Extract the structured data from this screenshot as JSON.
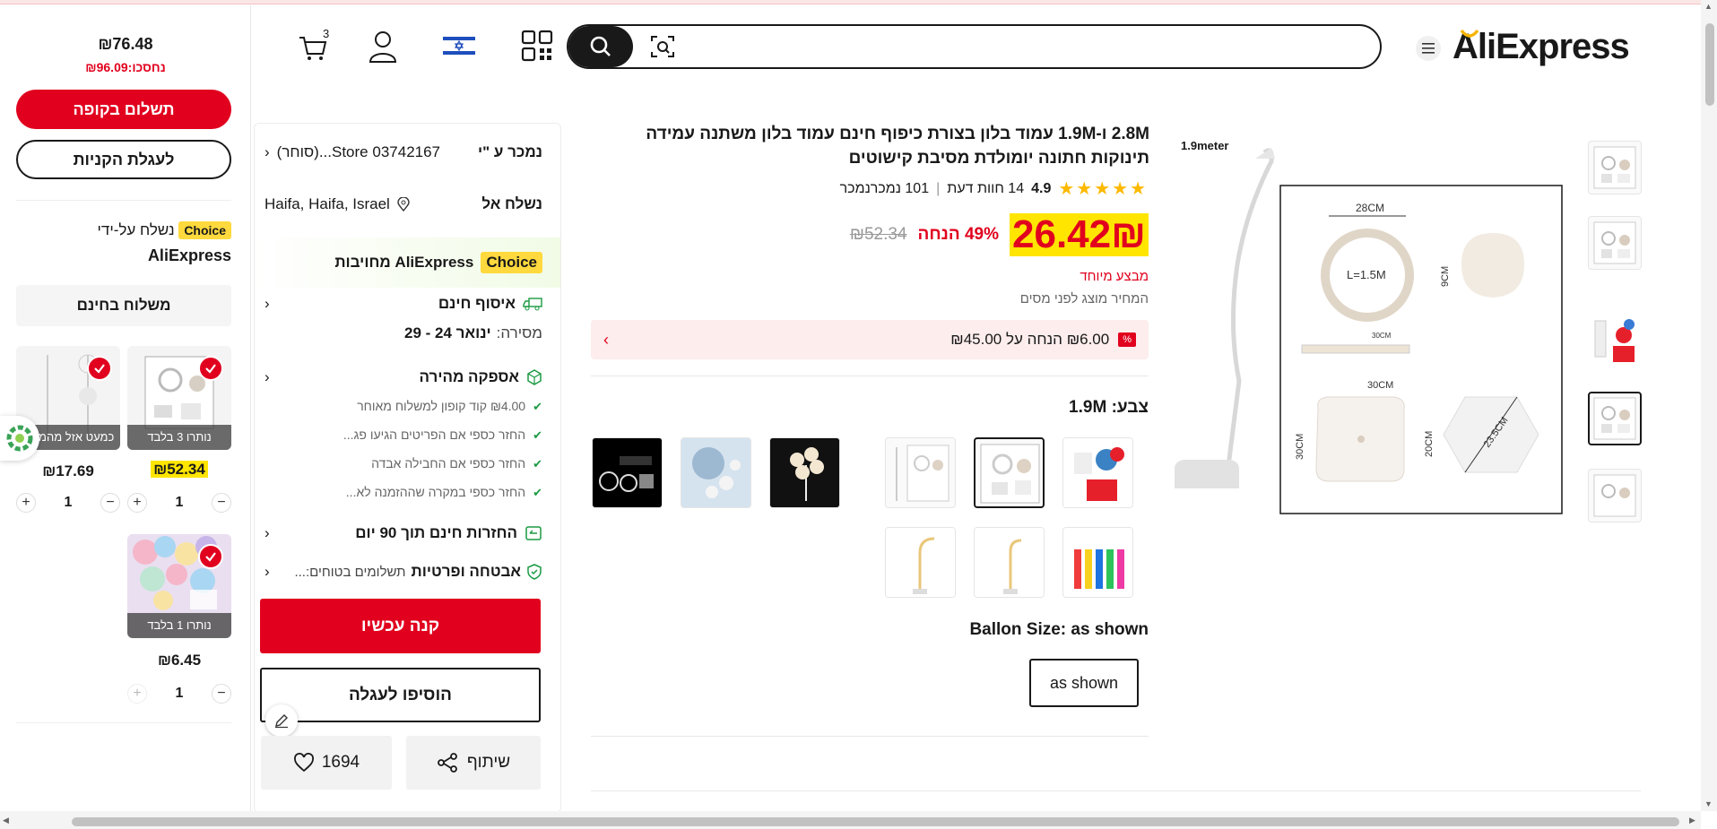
{
  "header": {
    "logo": "AliExpress",
    "cart_count": "3",
    "search_placeholder": "",
    "flag": "israel-flag"
  },
  "sidebar": {
    "total": "₪76.48",
    "saved": "נחסכו:₪96.09",
    "checkout_label": "תשלום בקופה",
    "to_cart_label": "לעגלת הקניות",
    "choice_badge": "Choice",
    "shipped_by": "נשלח על-ידי",
    "shipped_by_brand": "AliExpress",
    "free_shipping": "משלוח בחינם",
    "items": [
      {
        "caption": "נותרו 3 בלבד",
        "price": "₪52.34",
        "qty": "1"
      },
      {
        "caption": "כמעט אזל מהמלאי",
        "price": "₪17.69",
        "qty": "1"
      },
      {
        "caption": "נותרו 1 בלבד",
        "price": "₪6.45",
        "qty": "1"
      }
    ]
  },
  "product": {
    "title": "2.8M ו-1.9M עמוד בלון בצורת כיפוף חינם עמוד בלון משתנה עמידה תינוקות חתונה יומולדת מסיבת קישוטים",
    "rating": "4.9",
    "reviews": "14 חוות דעת",
    "sold": "101 נמכרנמכר",
    "price": "26.42₪",
    "discount": "49% הנחה",
    "old_price": "₪52.34",
    "special": "מבצע מיוחד",
    "tax_note": "המחיר מוצג לפני מסים",
    "coupon_text": "₪6.00 הנחה על ₪45.00",
    "color_label": "צבע: 1.9M",
    "size_label": "Ballon Size: as shown",
    "size_option": "as shown"
  },
  "buybox": {
    "sold_by_label": "נמכר ע \"י",
    "store": "03742167 Store...(סוחר)",
    "ship_to_label": "נשלח אל",
    "ship_to": "Haifa, Haifa, Israel",
    "choice_badge": "Choice",
    "choice_text": "AliExpress מחויבות",
    "pickup_title": "איסוף חינם",
    "delivery_label": "מסירה:",
    "delivery_dates": "ינואר 24 - 29",
    "fast_title": "אספקה מהירה",
    "fast_items": [
      "₪4.00 קוד קופון למשלוח מאוחר",
      "החזר כספי אם הפריטים הגיעו פג...",
      "החזר כספי אם החבילה אבדה",
      "החזר כספי במקרה שההזמנה לא..."
    ],
    "returns": "החזרות חינם תוך 90 יום",
    "security_title": "אבטחה ופרטיות",
    "security_text": "תשלומים בטוחים:...",
    "buy_now": "קנה עכשיו",
    "add_to_cart": "הוסיפו לעגלה",
    "wishlist_count": "1694",
    "share_label": "שיתוף"
  },
  "gallery": {
    "main_label": "1.9meter",
    "dims": {
      "ring": "28CM",
      "ring_inner": "L=1.5M",
      "cap": "9CM",
      "rod": "30CM",
      "base_w": "30CM",
      "base_h": "30CM",
      "hex_h": "20CM",
      "hex_d": "23.5CM"
    }
  },
  "colors": {
    "accent": "#e1001e",
    "choice": "#ffd93d",
    "price_yellow": "#ffe500"
  }
}
